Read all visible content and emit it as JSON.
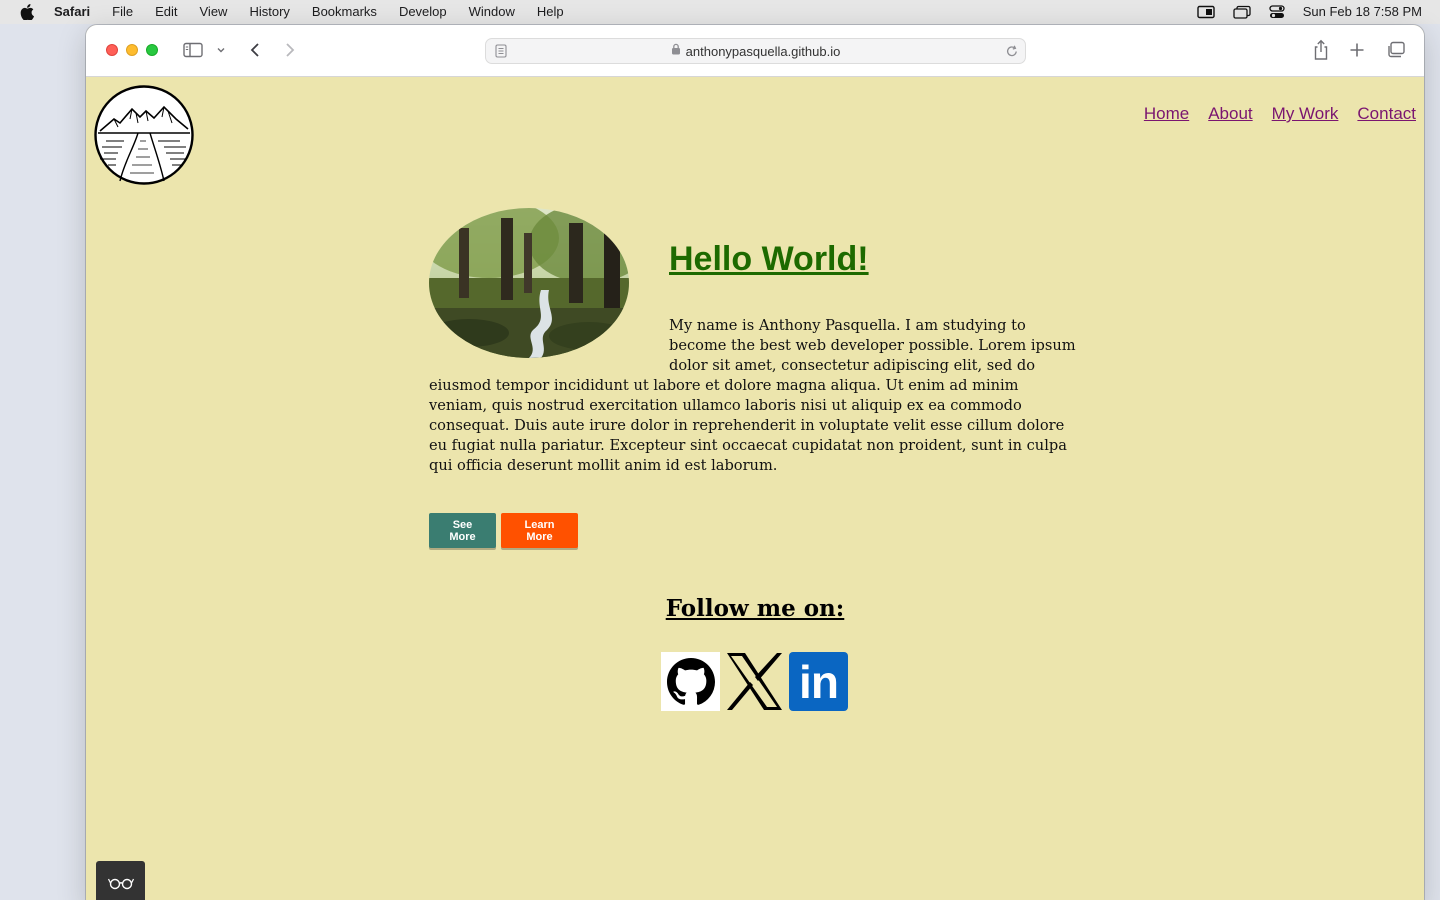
{
  "menubar": {
    "app_name": "Safari",
    "items": [
      "File",
      "Edit",
      "View",
      "History",
      "Bookmarks",
      "Develop",
      "Window",
      "Help"
    ],
    "clock": "Sun Feb 18  7:58 PM"
  },
  "browser": {
    "url": "anthonypasquella.github.io"
  },
  "page": {
    "nav": [
      "Home",
      "About",
      "My Work",
      "Contact"
    ],
    "heading": "Hello World!",
    "intro": "My name is Anthony Pasquella. I am studying to become the best web developer possible. Lorem ipsum dolor sit amet, consectetur adipiscing elit, sed do eiusmod tempor incididunt ut labore et dolore magna aliqua. Ut enim ad minim veniam, quis nostrud exercitation ullamco laboris nisi ut aliquip ex ea commodo consequat. Duis aute irure dolor in reprehenderit in voluptate velit esse cillum dolore eu fugiat nulla pariatur. Excepteur sint occaecat cupidatat non proident, sunt in culpa qui officia deserunt mollit anim id est laborum.",
    "buttons": {
      "see_more": "See More",
      "learn_more": "Learn More"
    },
    "follow_heading": "Follow me on:",
    "social": [
      "github-icon",
      "x-icon",
      "linkedin-icon"
    ],
    "linkedin_text": "in"
  },
  "colors": {
    "page_bg": "#ece5ad",
    "nav_link": "#7a1570",
    "heading": "#1d6a00",
    "see_more_bg": "#3a7d71",
    "learn_more_bg": "#ff5100",
    "linkedin_bg": "#0a66c2"
  }
}
